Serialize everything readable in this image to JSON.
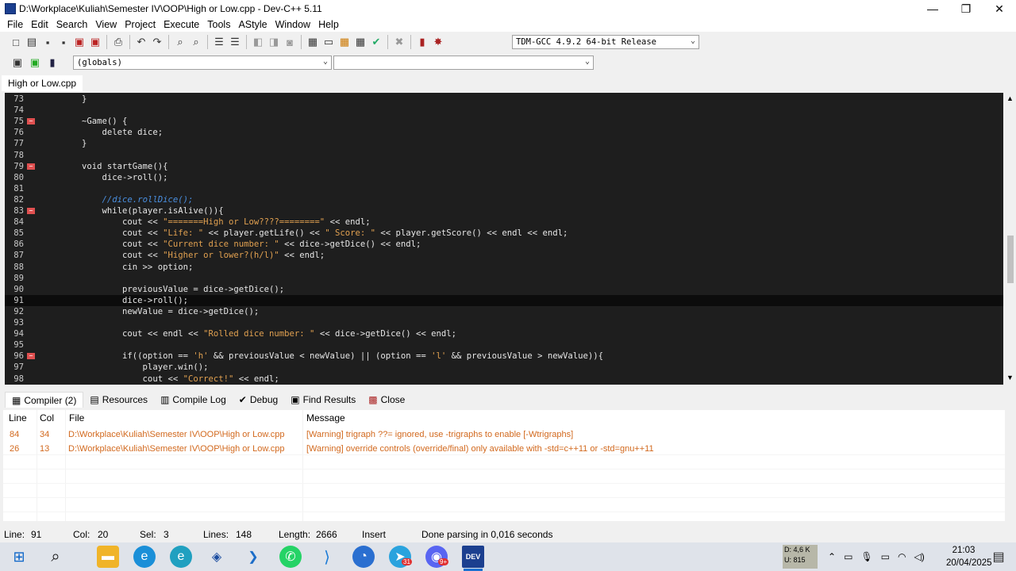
{
  "window": {
    "title": "D:\\Workplace\\Kuliah\\Semester IV\\OOP\\High or Low.cpp - Dev-C++ 5.11",
    "minimize": "—",
    "maximize": "❐",
    "close": "✕"
  },
  "menu": [
    "File",
    "Edit",
    "Search",
    "View",
    "Project",
    "Execute",
    "Tools",
    "AStyle",
    "Window",
    "Help"
  ],
  "compiler_select": "TDM-GCC 4.9.2 64-bit Release",
  "scope_select": "(globals)",
  "member_select": "",
  "file_tab": "High or Low.cpp",
  "code": [
    {
      "n": "73",
      "t": "        }",
      "fold": false
    },
    {
      "n": "74",
      "t": "",
      "fold": false
    },
    {
      "n": "75",
      "t": "        ~Game() {",
      "fold": true
    },
    {
      "n": "76",
      "t": "            delete dice;",
      "fold": false
    },
    {
      "n": "77",
      "t": "        }",
      "fold": false
    },
    {
      "n": "78",
      "t": "",
      "fold": false
    },
    {
      "n": "79",
      "t": "        void startGame(){",
      "fold": true
    },
    {
      "n": "80",
      "t": "            dice->roll();",
      "fold": false
    },
    {
      "n": "81",
      "t": "",
      "fold": false
    },
    {
      "n": "82",
      "t": "            //dice.rollDice();",
      "fold": false
    },
    {
      "n": "83",
      "t": "            while(player.isAlive()){",
      "fold": true
    },
    {
      "n": "84",
      "t": "                cout << \"=======High or Low????========\" << endl;",
      "fold": false
    },
    {
      "n": "85",
      "t": "                cout << \"Life: \" << player.getLife() << \" Score: \" << player.getScore() << endl << endl;",
      "fold": false
    },
    {
      "n": "86",
      "t": "                cout << \"Current dice number: \" << dice->getDice() << endl;",
      "fold": false
    },
    {
      "n": "87",
      "t": "                cout << \"Higher or lower?(h/l)\" << endl;",
      "fold": false
    },
    {
      "n": "88",
      "t": "                cin >> option;",
      "fold": false
    },
    {
      "n": "89",
      "t": "",
      "fold": false
    },
    {
      "n": "90",
      "t": "                previousValue = dice->getDice();",
      "fold": false
    },
    {
      "n": "91",
      "t": "                dice->roll();",
      "fold": false
    },
    {
      "n": "92",
      "t": "                newValue = dice->getDice();",
      "fold": false
    },
    {
      "n": "93",
      "t": "",
      "fold": false
    },
    {
      "n": "94",
      "t": "                cout << endl << \"Rolled dice number: \" << dice->getDice() << endl;",
      "fold": false
    },
    {
      "n": "95",
      "t": "",
      "fold": false
    },
    {
      "n": "96",
      "t": "                if((option == 'h' && previousValue < newValue) || (option == 'l' && previousValue > newValue)){",
      "fold": true
    },
    {
      "n": "97",
      "t": "                    player.win();",
      "fold": false
    },
    {
      "n": "98",
      "t": "                    cout << \"Correct!\" << endl;",
      "fold": false
    }
  ],
  "current_line_index": 18,
  "panel_tabs": [
    {
      "label": "Compiler (2)",
      "icon": "compiler-icon",
      "glyph": "▦"
    },
    {
      "label": "Resources",
      "icon": "resources-icon",
      "glyph": "▤"
    },
    {
      "label": "Compile Log",
      "icon": "compile-log-icon",
      "glyph": "▥"
    },
    {
      "label": "Debug",
      "icon": "debug-icon",
      "glyph": "✔"
    },
    {
      "label": "Find Results",
      "icon": "find-results-icon",
      "glyph": "▣"
    },
    {
      "label": "Close",
      "icon": "close-icon",
      "glyph": "▩"
    }
  ],
  "messages": {
    "headers": {
      "line": "Line",
      "col": "Col",
      "file": "File",
      "message": "Message"
    },
    "rows": [
      {
        "line": "84",
        "col": "34",
        "file": "D:\\Workplace\\Kuliah\\Semester IV\\OOP\\High or Low.cpp",
        "message": "[Warning] trigraph ??= ignored, use -trigraphs to enable [-Wtrigraphs]"
      },
      {
        "line": "26",
        "col": "13",
        "file": "D:\\Workplace\\Kuliah\\Semester IV\\OOP\\High or Low.cpp",
        "message": "[Warning] override controls (override/final) only available with -std=c++11 or -std=gnu++11"
      }
    ]
  },
  "status": {
    "line": "Line:",
    "line_val": "91",
    "col": "Col:",
    "col_val": "20",
    "sel": "Sel:",
    "sel_val": "3",
    "lines": "Lines:",
    "lines_val": "148",
    "length": "Length:",
    "length_val": "2666",
    "mode": "Insert",
    "parse": "Done parsing in 0,016 seconds"
  },
  "taskbar": {
    "disk_d": "D: 4,6 K",
    "disk_u": "U: 815",
    "time": "21:03",
    "date": "20/04/2025",
    "telegram_badge": "31",
    "discord_badge": "9+"
  },
  "colors": {
    "editor_bg": "#1e1e1e",
    "keyword": "#e6e6e6",
    "string": "#e0a050",
    "comment": "#4a90e2",
    "warning": "#d2691e"
  }
}
